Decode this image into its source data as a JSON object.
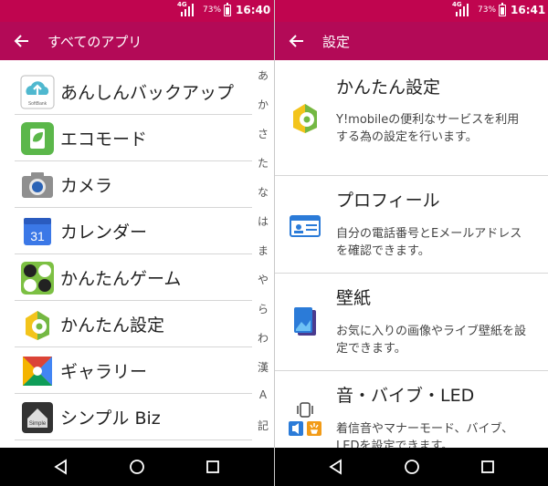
{
  "left_screen": {
    "status": {
      "signal": "4G",
      "battery": "73%",
      "time": "16:40"
    },
    "app_bar": {
      "title": "すべてのアプリ"
    },
    "apps": [
      {
        "label": "あんしんバックアップ",
        "icon": "anshin-backup-icon",
        "badge": "SoftBank"
      },
      {
        "label": "エコモード",
        "icon": "eco-mode-icon"
      },
      {
        "label": "カメラ",
        "icon": "camera-icon"
      },
      {
        "label": "カレンダー",
        "icon": "calendar-icon",
        "badge": "31"
      },
      {
        "label": "かんたんゲーム",
        "icon": "kantan-game-icon"
      },
      {
        "label": "かんたん設定",
        "icon": "kantan-settings-icon"
      },
      {
        "label": "ギャラリー",
        "icon": "gallery-icon"
      },
      {
        "label": "シンプル Biz",
        "icon": "simple-biz-icon",
        "badge": "Simple"
      }
    ],
    "index": [
      "あ",
      "か",
      "さ",
      "た",
      "な",
      "は",
      "ま",
      "や",
      "ら",
      "わ",
      "漢",
      "A",
      "記"
    ]
  },
  "right_screen": {
    "status": {
      "signal": "4G",
      "battery": "73%",
      "time": "16:41"
    },
    "app_bar": {
      "title": "設定"
    },
    "items": [
      {
        "title": "かんたん設定",
        "desc": "Y!mobileの便利なサービスを利用する為の設定を行います。",
        "icon": "kantan-settings-icon"
      },
      {
        "title": "プロフィール",
        "desc": "自分の電話番号とEメールアドレスを確認できます。",
        "icon": "profile-card-icon"
      },
      {
        "title": "壁紙",
        "desc": "お気に入りの画像やライブ壁紙を設定できます。",
        "icon": "wallpaper-icon"
      },
      {
        "title": "音・バイブ・LED",
        "desc": "着信音やマナーモード、バイブ、LEDを設定できます。",
        "icon": "sound-vibe-led-icon"
      }
    ]
  },
  "colors": {
    "status_bar": "#c0054f",
    "app_bar": "#b30a57",
    "nav_bar": "#000000"
  }
}
